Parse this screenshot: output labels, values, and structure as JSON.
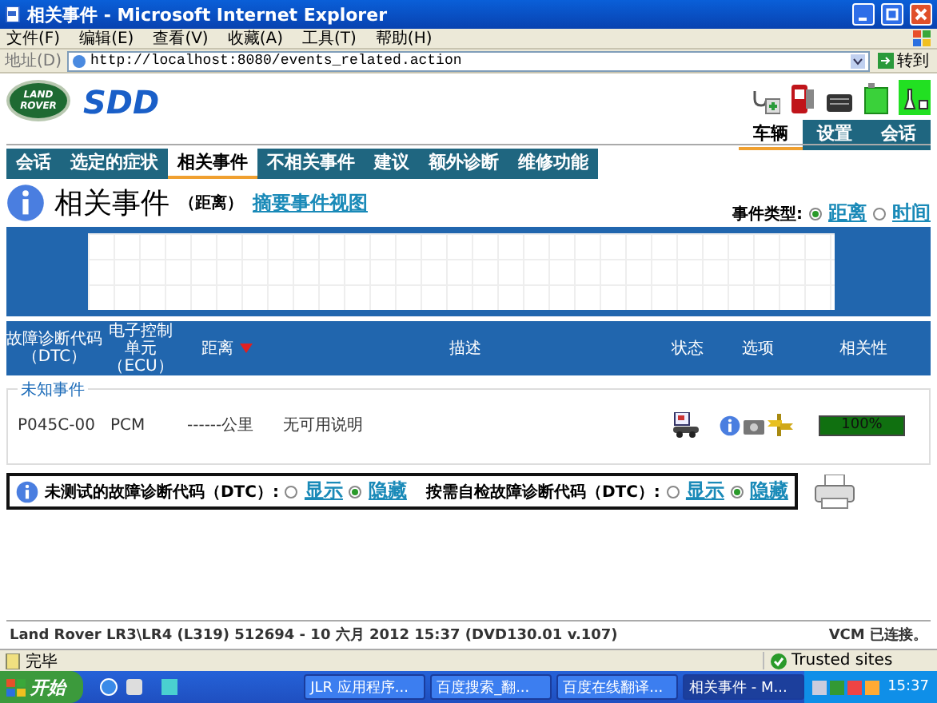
{
  "window": {
    "title": "相关事件 - Microsoft Internet Explorer"
  },
  "menu": [
    "文件(F)",
    "编辑(E)",
    "查看(V)",
    "收藏(A)",
    "工具(T)",
    "帮助(H)"
  ],
  "address": {
    "label": "地址(D)",
    "url": "http://localhost:8080/events_related.action",
    "go": "转到"
  },
  "header": {
    "logo": [
      "LAND",
      "ROVER"
    ],
    "product": "SDD",
    "top_tabs": [
      {
        "label": "车辆",
        "selected": true
      },
      {
        "label": "设置",
        "selected": false
      },
      {
        "label": "会话",
        "selected": false
      }
    ]
  },
  "nav_tabs": [
    {
      "label": "会话",
      "selected": false
    },
    {
      "label": "选定的症状",
      "selected": false
    },
    {
      "label": "相关事件",
      "selected": true
    },
    {
      "label": "不相关事件",
      "selected": false
    },
    {
      "label": "建议",
      "selected": false
    },
    {
      "label": "额外诊断",
      "selected": false
    },
    {
      "label": "维修功能",
      "selected": false
    }
  ],
  "page": {
    "title": "相关事件",
    "subtitle": "（距离）",
    "summary_link": "摘要事件视图",
    "event_type": {
      "label": "事件类型:",
      "options": [
        {
          "label": "距离",
          "selected": true
        },
        {
          "label": "时间",
          "selected": false
        }
      ]
    }
  },
  "table": {
    "columns": [
      {
        "label": "故障诊断代码（DTC）",
        "sorted": false
      },
      {
        "label": "电子控制单元（ECU）",
        "sorted": false
      },
      {
        "label": "距离",
        "sorted": true
      },
      {
        "label": "描述",
        "sorted": false
      },
      {
        "label": "状态",
        "sorted": false
      },
      {
        "label": "选项",
        "sorted": false
      },
      {
        "label": "相关性",
        "sorted": false
      }
    ],
    "group": {
      "title": "未知事件",
      "rows": [
        {
          "dtc": "P045C-00",
          "ecu": "PCM",
          "distance": "------公里",
          "description": "无可用说明",
          "relevance": "100%",
          "level": 1
        }
      ]
    }
  },
  "filters": [
    {
      "label": "未测试的故障诊断代码（DTC）:",
      "options": [
        {
          "label": "显示",
          "selected": false
        },
        {
          "label": "隐藏",
          "selected": true
        }
      ]
    },
    {
      "label": "按需自检故障诊断代码（DTC）:",
      "options": [
        {
          "label": "显示",
          "selected": false
        },
        {
          "label": "隐藏",
          "selected": true
        }
      ]
    }
  ],
  "footer": {
    "vehicle": "Land Rover LR3\\LR4 (L319) 512694 - 10 六月  2012 15:37 (DVD130.01 v.107)",
    "status": "VCM 已连接。"
  },
  "status_bar": {
    "text": "完毕",
    "zone": "Trusted sites"
  },
  "taskbar": {
    "start": "开始",
    "tasks": [
      {
        "label": "JLR 应用程序...",
        "selected": false
      },
      {
        "label": "百度搜索_翻...",
        "selected": false
      },
      {
        "label": "百度在线翻译...",
        "selected": false
      },
      {
        "label": "相关事件 - M...",
        "selected": true
      }
    ],
    "clock": "15:37"
  }
}
